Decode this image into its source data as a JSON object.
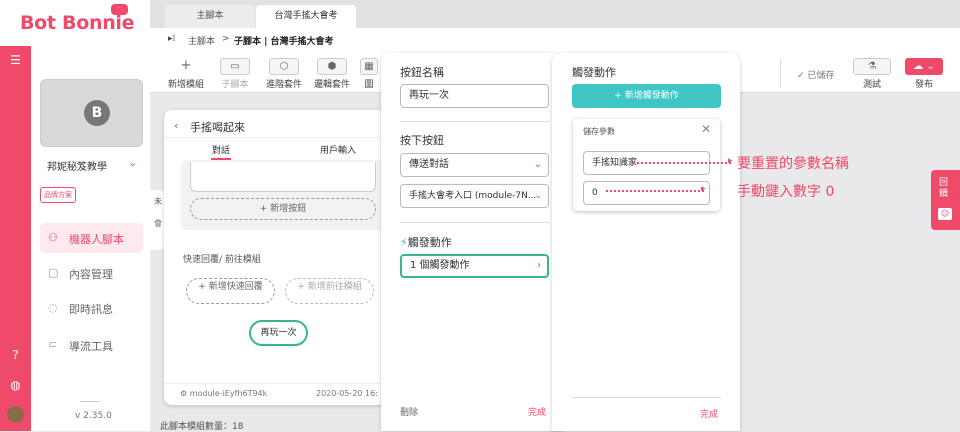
{
  "brand": {
    "logo": "Bot Bonnie",
    "bubble": "···",
    "accent": "#f04a6a"
  },
  "sidebar": {
    "bot_name": "邦妮秘笈教學",
    "plan_badge": "品牌方案",
    "items": [
      {
        "label": "機器人腳本",
        "icon": "flow-icon",
        "active": true
      },
      {
        "label": "內容管理",
        "icon": "content-icon"
      },
      {
        "label": "即時訊息",
        "icon": "chat-icon"
      },
      {
        "label": "導流工具",
        "icon": "magnet-icon"
      }
    ],
    "version": "v 2.35.0",
    "avatar_letter": "B"
  },
  "tabs": [
    {
      "label": "主腳本"
    },
    {
      "label": "台灣手搖大會考"
    }
  ],
  "breadcrumb": {
    "root": "主腳本",
    "separator": ">",
    "current": "子腳本 | 台灣手搖大會考"
  },
  "toolbar": {
    "items": [
      {
        "label": "新增模組",
        "icon": "+"
      },
      {
        "label": "子腳本",
        "icon": "▭"
      },
      {
        "label": "進階套件",
        "icon": "⬡"
      },
      {
        "label": "邏輯套件",
        "icon": "⬢"
      },
      {
        "label": "圖",
        "icon": "▦"
      }
    ],
    "saved": "已儲存",
    "test": "測試",
    "publish": "發布"
  },
  "module": {
    "title": "手搖喝起來",
    "tabs": [
      "對話",
      "用戶輸入"
    ],
    "add_button": "+ 新增按鈕",
    "quick_reply_label": "快速回覆/ 前往模組",
    "add_quick_reply": "+ 新增快速回覆",
    "add_goto": "+ 新增前往模組",
    "chip": "再玩一次",
    "module_id": "module-iEyfh6T94k",
    "date": "2020-05-20 16:",
    "bg_text_1": "未",
    "bg_text_2": "會"
  },
  "status": {
    "module_count": "此腳本模組數量：18"
  },
  "button_panel": {
    "name_label": "按鈕名稱",
    "name_value": "再玩一次",
    "press_label": "按下按鈕",
    "action_value": "傳送對話",
    "target_value": "手搖大會考入口 (module-7N...",
    "trigger_label": "觸發動作",
    "trigger_value": "1 個觸發動作",
    "delete": "刪除",
    "done": "完成"
  },
  "trigger_panel": {
    "title": "觸發動作",
    "add_button": "+ 新增觸發動作",
    "param_title": "儲存參數",
    "param_name": "手搖知識家",
    "param_value": "0",
    "done": "完成"
  },
  "annotations": {
    "a1": "要重置的參數名稱",
    "a2": "手動鍵入數字 0"
  },
  "right_widget": {
    "label": "回饋"
  }
}
